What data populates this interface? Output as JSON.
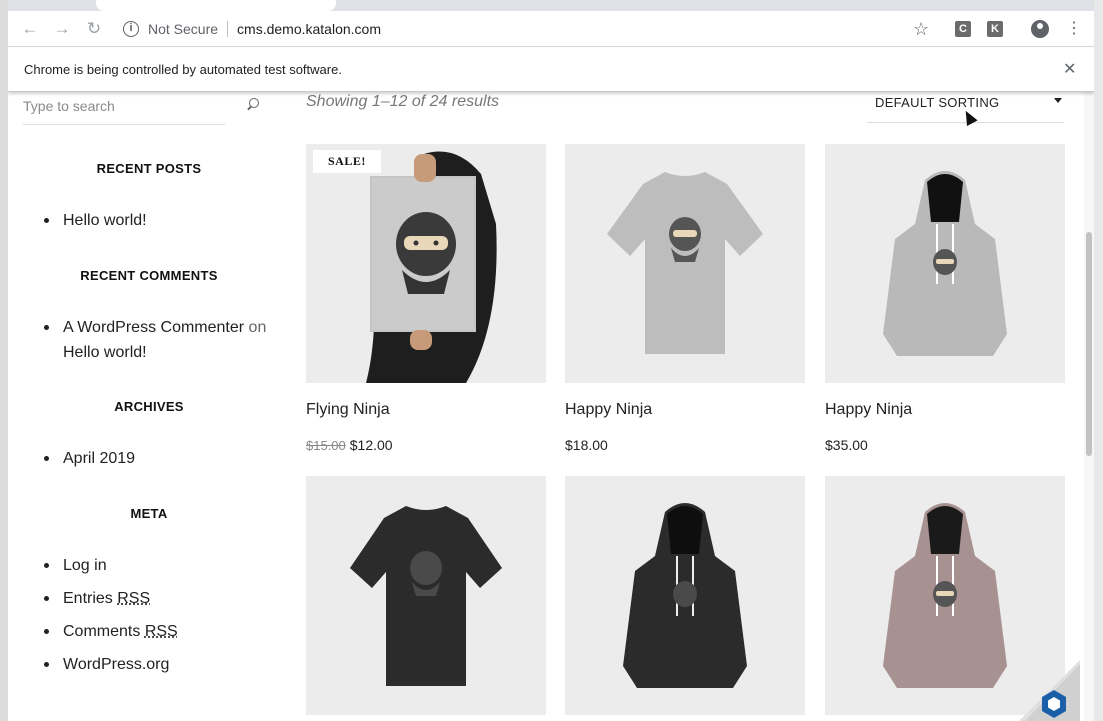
{
  "browser": {
    "security_label": "Not Secure",
    "url": "cms.demo.katalon.com",
    "extensions": [
      "C",
      "K"
    ],
    "infobar_message": "Chrome is being controlled by automated test software."
  },
  "sidebar": {
    "search_placeholder": "Type to search",
    "recent_posts": {
      "title": "RECENT POSTS",
      "items": [
        "Hello world!"
      ]
    },
    "recent_comments": {
      "title": "RECENT COMMENTS",
      "author": "A WordPress Commenter",
      "on": "on",
      "post": "Hello world!"
    },
    "archives": {
      "title": "ARCHIVES",
      "items": [
        "April 2019"
      ]
    },
    "meta": {
      "title": "META",
      "login": "Log in",
      "entries_prefix": "Entries",
      "comments_prefix": "Comments",
      "rss": "RSS",
      "wordpress": "WordPress.org"
    }
  },
  "shop": {
    "results_text": "Showing 1–12 of 24 results",
    "sort_label": "DEFAULT SORTING",
    "sale_badge": "SALE!",
    "products": [
      {
        "name": "Flying Ninja",
        "old_price": "$15.00",
        "price": "$12.00"
      },
      {
        "name": "Happy Ninja",
        "price": "$18.00"
      },
      {
        "name": "Happy Ninja",
        "price": "$35.00"
      },
      {
        "name": "",
        "price": ""
      },
      {
        "name": "",
        "price": ""
      },
      {
        "name": "",
        "price": ""
      }
    ]
  },
  "colors": {
    "tshirt_grey": "#bdbdbd",
    "hoodie_grey": "#b9b9b9",
    "black": "#2b2b2b",
    "hoodie_pink": "#a89191"
  }
}
